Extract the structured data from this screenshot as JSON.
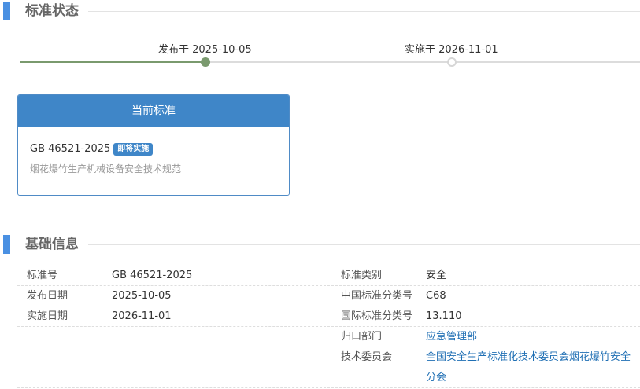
{
  "status": {
    "title": "标准状态",
    "published": "发布于 2025-10-05",
    "effective": "实施于 2026-11-01"
  },
  "current_card": {
    "header": "当前标准",
    "code": "GB 46521-2025",
    "badge": "即将实施",
    "name": "烟花爆竹生产机械设备安全技术规范"
  },
  "basic_info": {
    "title": "基础信息",
    "rows": [
      {
        "k1": "标准号",
        "v1": "GB 46521-2025",
        "k2": "标准类别",
        "v2": "安全"
      },
      {
        "k1": "发布日期",
        "v1": "2025-10-05",
        "k2": "中国标准分类号",
        "v2": "C68"
      },
      {
        "k1": "实施日期",
        "v1": "2026-11-01",
        "k2": "国际标准分类号",
        "v2": "13.110"
      },
      {
        "k1": "",
        "v1": "",
        "k2": "归口部门",
        "v2": "应急管理部"
      },
      {
        "k1": "",
        "v1": "",
        "k2": "技术委员会",
        "v2": "全国安全生产标准化技术委员会烟花爆竹安全分会"
      }
    ]
  },
  "colors": {
    "accent": "#4a90e2",
    "card_header": "#3f86c8",
    "timeline_done": "#7a9a6e",
    "link": "#1f6fb4"
  }
}
